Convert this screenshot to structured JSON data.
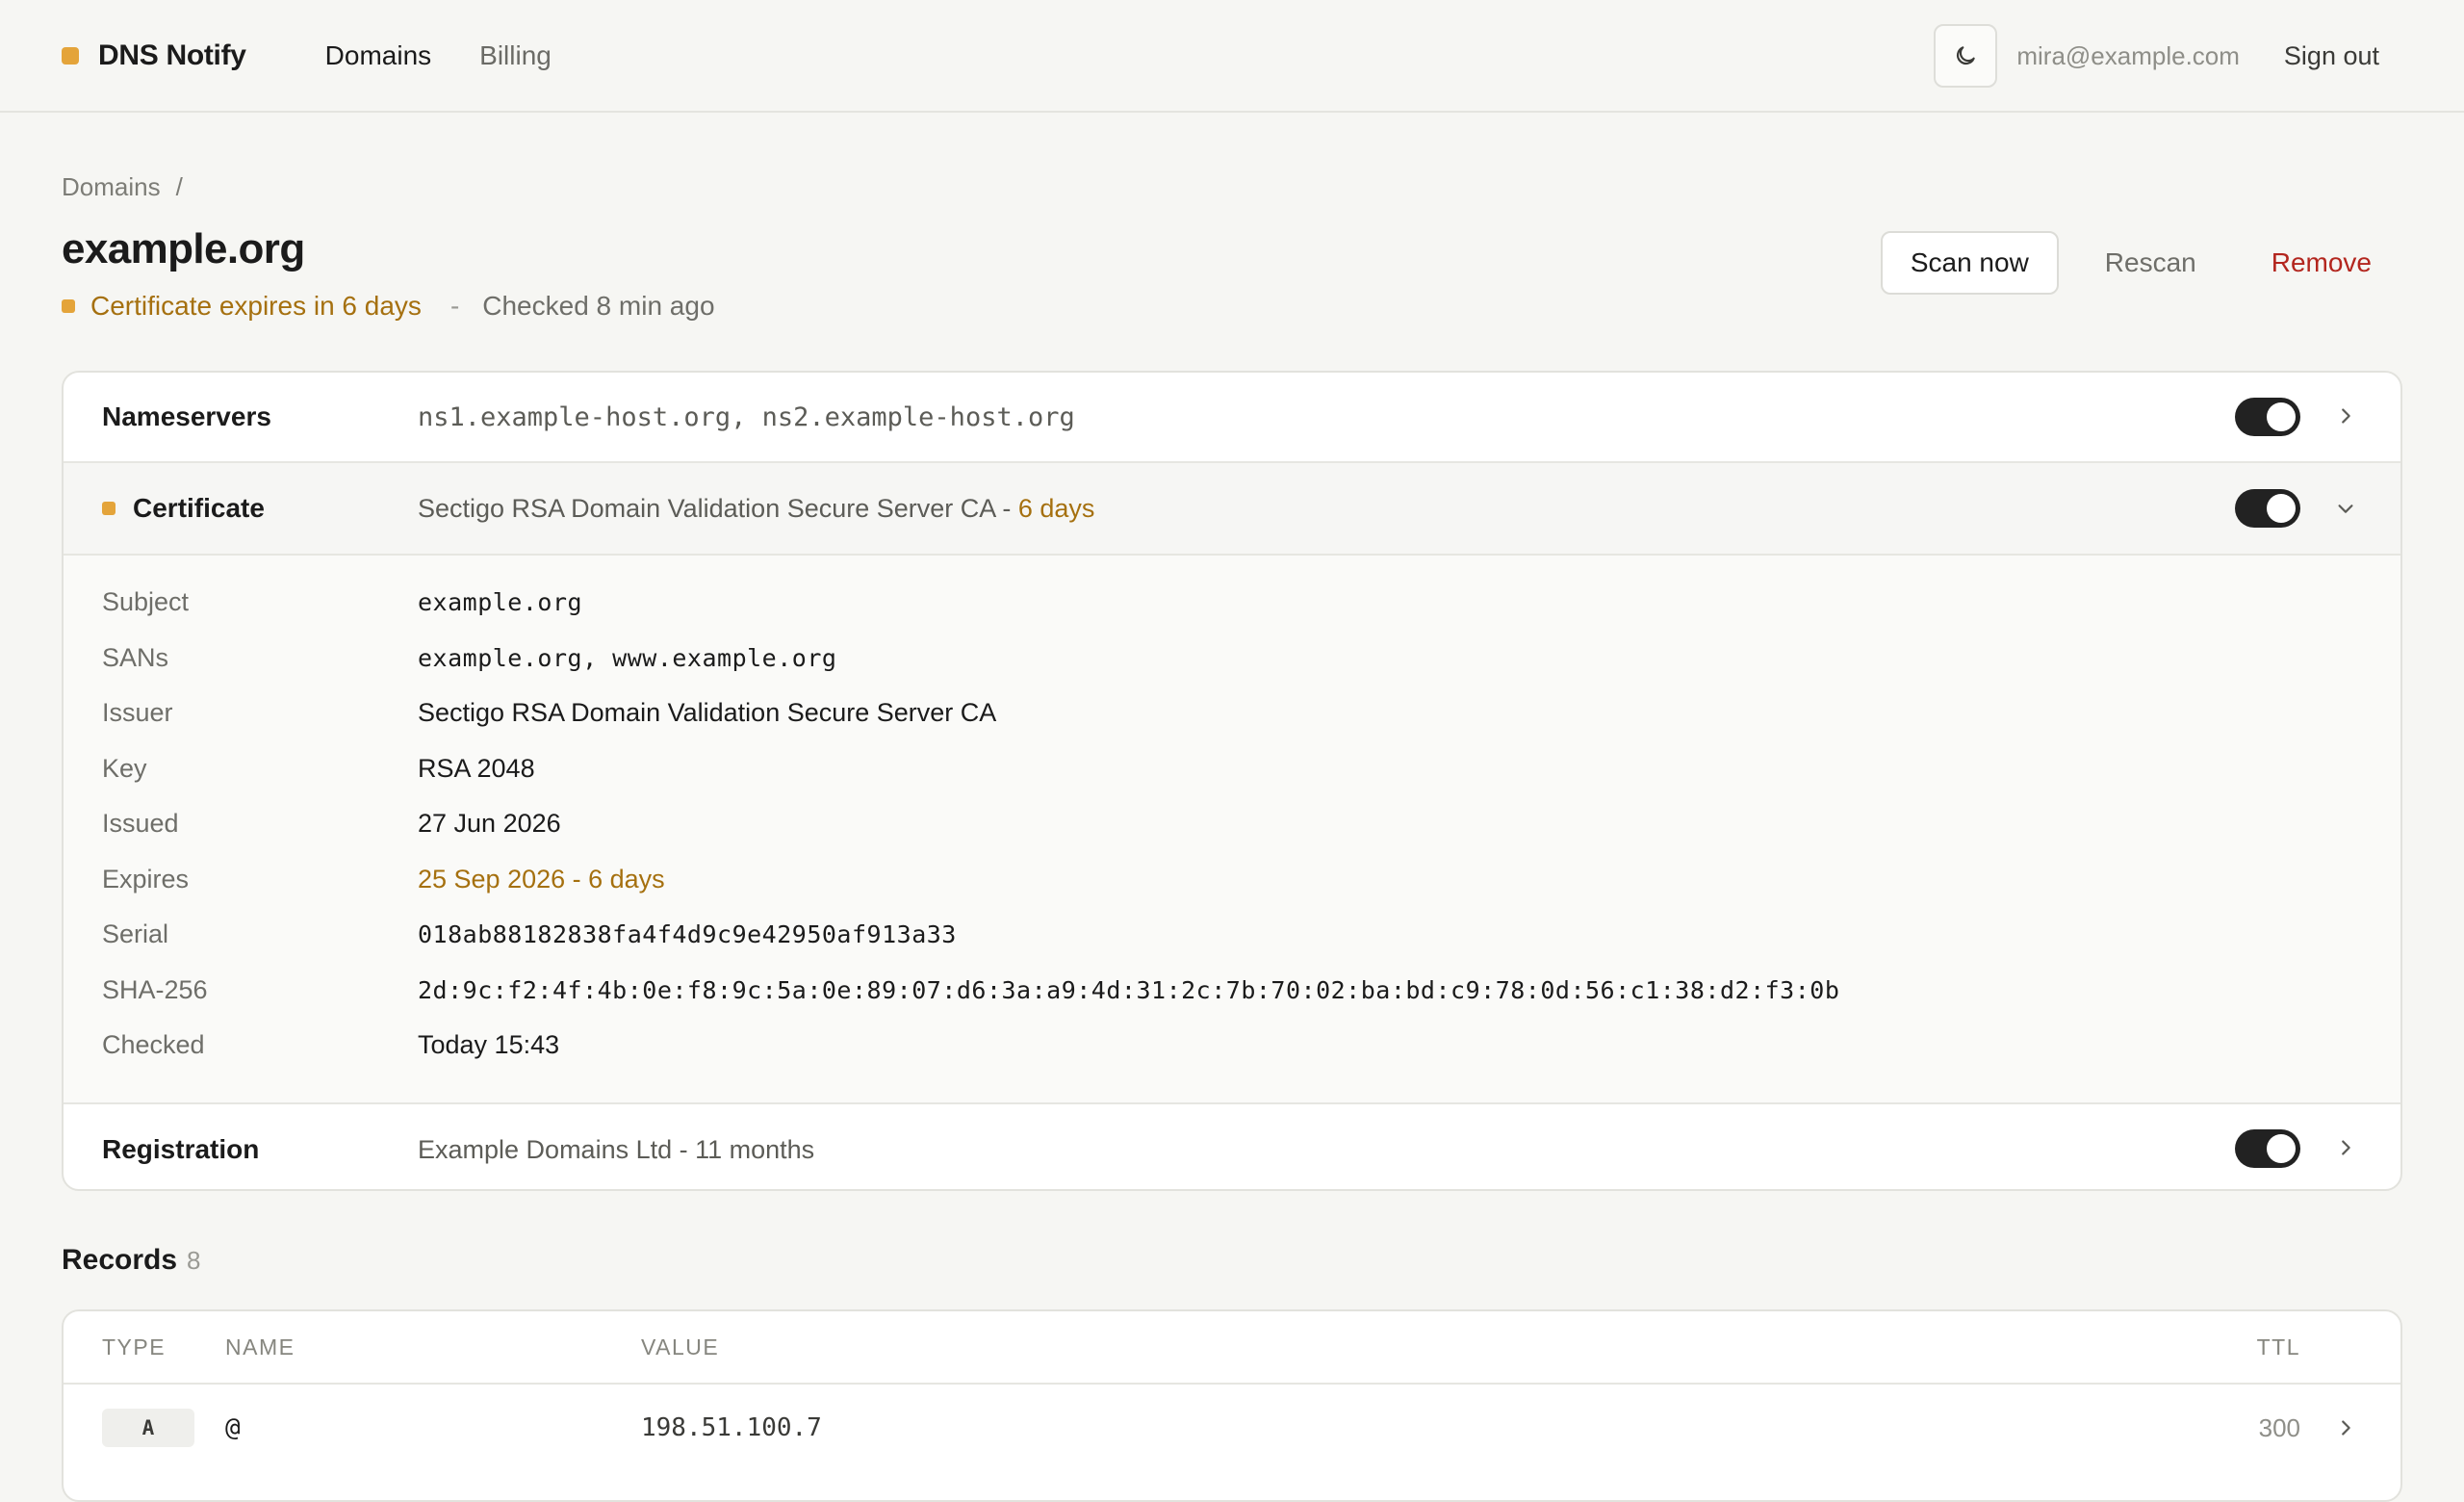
{
  "app": {
    "name": "DNS Notify",
    "brand_color": "#e4a43a"
  },
  "nav": {
    "items": [
      {
        "label": "Domains",
        "active": true
      },
      {
        "label": "Billing",
        "active": false
      }
    ]
  },
  "user": {
    "email": "mira@example.com",
    "sign_out": "Sign out",
    "theme_icon": "moon-icon"
  },
  "breadcrumb": {
    "root": "Domains",
    "separator": "/"
  },
  "domain": {
    "title": "example.org",
    "status": "Certificate expires in 6 days",
    "separator": "-",
    "checked": "Checked 8 min ago"
  },
  "actions": {
    "scan": "Scan now",
    "rescan": "Rescan",
    "remove": "Remove"
  },
  "checks": {
    "nameservers": {
      "label": "Nameservers",
      "value": "ns1.example-host.org, ns2.example-host.org",
      "enabled": true
    },
    "certificate": {
      "label": "Certificate",
      "issuer": "Sectigo RSA Domain Validation Secure Server CA",
      "dash": " - ",
      "remaining": "6 days",
      "enabled": true,
      "expanded": true
    },
    "registration": {
      "label": "Registration",
      "value": "Example Domains Ltd - 11 months",
      "enabled": true
    }
  },
  "certificate_details": [
    {
      "label": "Subject",
      "value": "example.org"
    },
    {
      "label": "SANs",
      "value": "example.org, www.example.org"
    },
    {
      "label": "Issuer",
      "value": "Sectigo RSA Domain Validation Secure Server CA"
    },
    {
      "label": "Key",
      "value": "RSA 2048"
    },
    {
      "label": "Issued",
      "value": "27 Jun 2026"
    },
    {
      "label": "Expires",
      "value": "25 Sep 2026 - 6 days"
    },
    {
      "label": "Serial",
      "value": "018ab88182838fa4f4d9c9e42950af913a33"
    },
    {
      "label": "SHA-256",
      "value": "2d:9c:f2:4f:4b:0e:f8:9c:5a:0e:89:07:d6:3a:a9:4d:31:2c:7b:70:02:ba:bd:c9:78:0d:56:c1:38:d2:f3:0b"
    },
    {
      "label": "Checked",
      "value": "Today 15:43"
    }
  ],
  "records": {
    "title": "Records",
    "count": "8",
    "columns": {
      "type": "TYPE",
      "name": "NAME",
      "value": "VALUE",
      "ttl": "TTL"
    },
    "rows": [
      {
        "type": "A",
        "name": "@",
        "value": "198.51.100.7",
        "ttl": "300"
      }
    ]
  },
  "colors": {
    "warning": "#a5700f",
    "danger": "#b3261e",
    "background": "#f6f6f3"
  }
}
